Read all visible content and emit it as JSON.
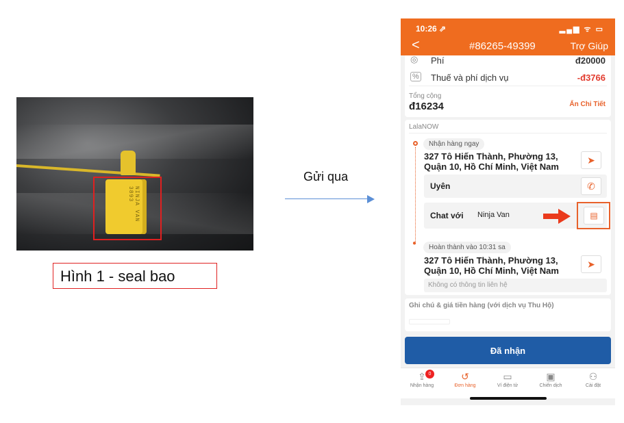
{
  "left_panel": {
    "caption": "Hình 1 - seal bao",
    "seal_text": "NINJA VAN 3893"
  },
  "middle": {
    "label": "Gửi qua"
  },
  "phone": {
    "status": {
      "time": "10:26 ⇗",
      "icons": "▂▄▆ ᯤ ▭"
    },
    "nav": {
      "back": "<",
      "order_id": "#86265-49399",
      "help": "Trợ Giúp"
    },
    "fees": {
      "fee_label": "Phí",
      "fee_value": "đ20000",
      "tax_label": "Thuế và phí dịch vụ",
      "tax_value": "-đ3766",
      "total_label": "Tổng cộng",
      "total_value": "đ16234",
      "hide_detail": "Ẩn Chi Tiết"
    },
    "delivery": {
      "provider": "LalaNOW",
      "pickup_pill": "Nhận hàng ngay",
      "pickup_address_line1": "327 Tô Hiến Thành, Phường 13,",
      "pickup_address_line2": "Quận 10, Hồ Chí Minh, Việt Nam",
      "contact_name": "Uyên",
      "chat_label": "Chat với",
      "chat_target": "Ninja Van",
      "done_pill": "Hoàn thành vào 10:31 sa",
      "drop_address_line1": "327 Tô Hiến Thành, Phường 13,",
      "drop_address_line2": "Quận 10, Hồ Chí Minh, Việt Nam",
      "no_contact": "Không có thông tin liên hệ"
    },
    "notes_label": "Ghi chú & giá tiền hàng (với dịch vụ Thu Hộ)",
    "primary_button": "Đã nhận",
    "tabs": [
      {
        "label": "Nhận hàng",
        "icon": "upload-icon",
        "badge": "0"
      },
      {
        "label": "Đơn hàng",
        "icon": "history-icon"
      },
      {
        "label": "Ví điện tử",
        "icon": "wallet-icon"
      },
      {
        "label": "Chiến dịch",
        "icon": "campaign-icon"
      },
      {
        "label": "Cài đặt",
        "icon": "user-icon"
      }
    ],
    "colors": {
      "brand": "#ef6c1f",
      "primary_button": "#1f5ca6",
      "accent": "#e8612a"
    }
  }
}
